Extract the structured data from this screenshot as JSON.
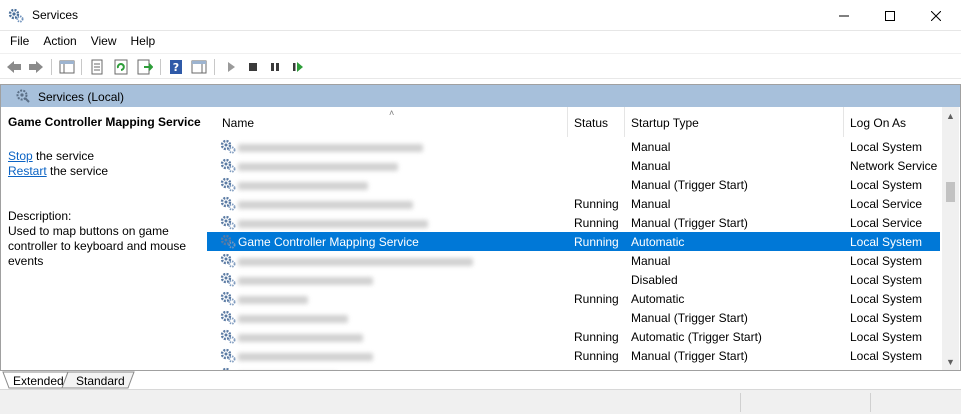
{
  "window": {
    "title": "Services"
  },
  "menu": [
    "File",
    "Action",
    "View",
    "Help"
  ],
  "toolbar": {
    "icons": [
      "back-icon",
      "forward-icon",
      "show-tree-icon",
      "properties-icon",
      "refresh-icon",
      "export-list-icon",
      "help-icon",
      "show-hide-action-pane-icon",
      "start-icon",
      "stop-icon",
      "pause-icon",
      "restart-icon"
    ]
  },
  "header": {
    "title": "Services (Local)"
  },
  "left_pane": {
    "service_name": "Game Controller Mapping Service",
    "stop_link": "Stop",
    "stop_rest": " the service",
    "restart_link": "Restart",
    "restart_rest": " the service",
    "description_label": "Description:",
    "description": "Used to map buttons on game controller to keyboard and mouse events"
  },
  "columns": [
    "Name",
    "Status",
    "Startup Type",
    "Log On As"
  ],
  "rows": [
    {
      "name": "",
      "status": "",
      "startup": "Manual",
      "logon": "Local System"
    },
    {
      "name": "",
      "status": "",
      "startup": "Manual",
      "logon": "Network Service"
    },
    {
      "name": "",
      "status": "",
      "startup": "Manual (Trigger Start)",
      "logon": "Local System"
    },
    {
      "name": "",
      "status": "Running",
      "startup": "Manual",
      "logon": "Local Service"
    },
    {
      "name": "",
      "status": "Running",
      "startup": "Manual (Trigger Start)",
      "logon": "Local Service"
    },
    {
      "name": "Game Controller Mapping Service",
      "status": "Running",
      "startup": "Automatic",
      "logon": "Local System",
      "selected": true
    },
    {
      "name": "",
      "status": "",
      "startup": "Manual",
      "logon": "Local System"
    },
    {
      "name": "",
      "status": "",
      "startup": "Disabled",
      "logon": "Local System"
    },
    {
      "name": "",
      "status": "Running",
      "startup": "Automatic",
      "logon": "Local System"
    },
    {
      "name": "",
      "status": "",
      "startup": "Manual (Trigger Start)",
      "logon": "Local System"
    },
    {
      "name": "",
      "status": "Running",
      "startup": "Automatic (Trigger Start)",
      "logon": "Local System"
    },
    {
      "name": "",
      "status": "Running",
      "startup": "Manual (Trigger Start)",
      "logon": "Local System"
    },
    {
      "name": "",
      "status": "",
      "startup": "Manual (Trigger Start)",
      "logon": "Local System"
    }
  ],
  "tabs": [
    "Extended",
    "Standard"
  ],
  "colors": {
    "selection": "#0078d7",
    "header_band": "#a7c0db",
    "link": "#0b63c4"
  }
}
